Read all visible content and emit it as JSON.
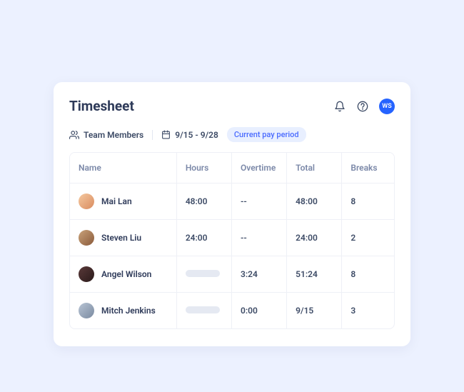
{
  "header": {
    "title": "Timesheet",
    "avatar_initials": "WS"
  },
  "filters": {
    "team_label": "Team Members",
    "date_range": "9/15 - 9/28",
    "pill": "Current pay period"
  },
  "table": {
    "columns": {
      "name": "Name",
      "hours": "Hours",
      "overtime": "Overtime",
      "total": "Total",
      "breaks": "Breaks"
    },
    "rows": [
      {
        "name": "Mai Lan",
        "hours": "48:00",
        "overtime": "--",
        "total": "48:00",
        "breaks": "8",
        "avatar_bg": "linear-gradient(135deg,#f5c9a0,#d98b5f)"
      },
      {
        "name": "Steven Liu",
        "hours": "24:00",
        "overtime": "--",
        "total": "24:00",
        "breaks": "2",
        "avatar_bg": "linear-gradient(135deg,#c9a27a,#8a5a3a)"
      },
      {
        "name": "Angel Wilson",
        "hours": "",
        "overtime": "3:24",
        "total": "51:24",
        "breaks": "8",
        "avatar_bg": "linear-gradient(135deg,#5a3a3a,#2a1a1a)"
      },
      {
        "name": "Mitch Jenkins",
        "hours": "",
        "overtime": "0:00",
        "total": "9/15",
        "breaks": "3",
        "avatar_bg": "linear-gradient(135deg,#b8c4d4,#7a8aa0)"
      }
    ]
  }
}
